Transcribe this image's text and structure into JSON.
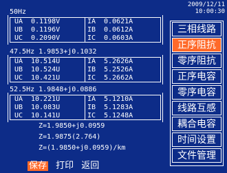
{
  "datetime": {
    "date": "2009/12/11",
    "time": "10:00:30"
  },
  "sections": [
    {
      "freq": "50Hz",
      "rows": [
        {
          "u_label": "UA",
          "u_value": "0.1198V",
          "i_label": "IA",
          "i_value": "0.0621A"
        },
        {
          "u_label": "UB",
          "u_value": "0.1196V",
          "i_label": "IB",
          "i_value": "0.0612A"
        },
        {
          "u_label": "UC",
          "u_value": "0.2090V",
          "i_label": "IC",
          "i_value": "0.0603A"
        }
      ]
    },
    {
      "freq": "47.5Hz 1.9853+j0.1032",
      "rows": [
        {
          "u_label": "UA",
          "u_value": "10.514U",
          "i_label": "IA",
          "i_value": "5.2626A"
        },
        {
          "u_label": "UB",
          "u_value": "10.524U",
          "i_label": "IB",
          "i_value": "5.2526A"
        },
        {
          "u_label": "UC",
          "u_value": "10.421U",
          "i_label": "IC",
          "i_value": "5.2662A"
        }
      ]
    },
    {
      "freq": "52.5Hz 1.9848+j0.0886",
      "rows": [
        {
          "u_label": "UA",
          "u_value": "10.221U",
          "i_label": "IA",
          "i_value": "5.1210A"
        },
        {
          "u_label": "UB",
          "u_value": "10.083U",
          "i_label": "IB",
          "i_value": "5.1283A"
        },
        {
          "u_label": "UC",
          "u_value": "10.141U",
          "i_label": "IC",
          "i_value": "5.1248A"
        }
      ]
    }
  ],
  "results": [
    "Z=1.9850+j0.0959",
    "Z=1.9875(2.764)",
    "Z=(1.9850+j0.0959)/km"
  ],
  "menu": [
    {
      "label": "三相线路",
      "active": false
    },
    {
      "label": "正序阻抗",
      "active": true
    },
    {
      "label": "零序阻抗",
      "active": false
    },
    {
      "label": "正序电容",
      "active": false
    },
    {
      "label": "零序电容",
      "active": false
    },
    {
      "label": "线路互感",
      "active": false
    },
    {
      "label": "耦合电容",
      "active": false
    },
    {
      "label": "时间设置",
      "active": false
    },
    {
      "label": "文件管理",
      "active": false
    }
  ],
  "bottom": {
    "save": "保存",
    "print": "打印",
    "back": "返回"
  }
}
